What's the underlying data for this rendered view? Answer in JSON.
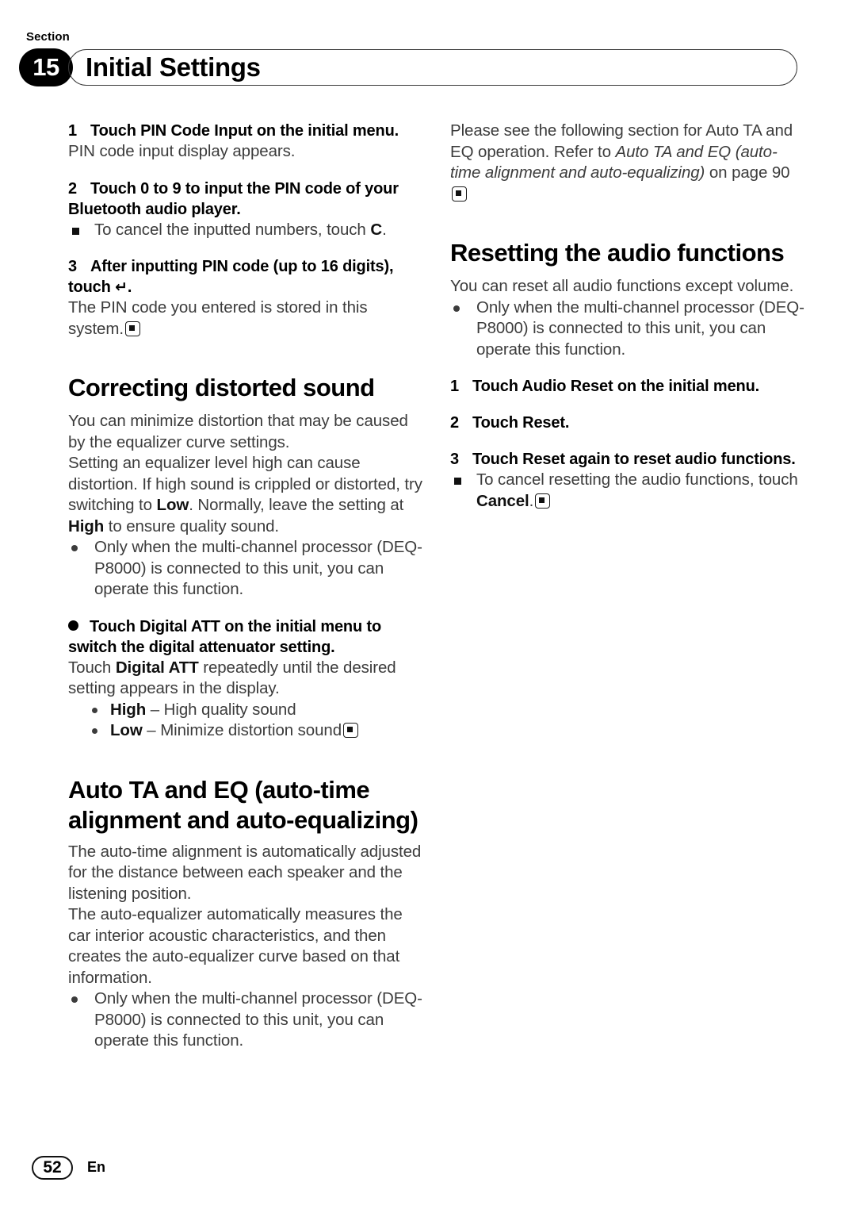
{
  "header": {
    "section_label": "Section",
    "section_number": "15",
    "title": "Initial Settings"
  },
  "left_column": {
    "steps": [
      {
        "num": "1",
        "text_pre": "Touch ",
        "text_bold": "PIN Code Input",
        "text_post": " on the initial menu.",
        "full": "1   Touch PIN Code Input on the initial menu.",
        "body": "PIN code input display appears."
      },
      {
        "num": "2",
        "full": "2   Touch 0 to 9 to input the PIN code of your Bluetooth audio player.",
        "note_pre": "To cancel the inputted numbers, touch ",
        "note_bold": "C",
        "note_post": "."
      },
      {
        "num": "3",
        "full": "3   After inputting PIN code (up to 16 digits), touch ",
        "key_glyph": "↵",
        "full_tail": ".",
        "body": "The PIN code you entered is stored in this system."
      }
    ],
    "heading_correcting": "Correcting distorted sound",
    "correcting_para_1": "You can minimize distortion that may be caused by the equalizer curve settings.",
    "correcting_para_2_a": "Setting an equalizer level high can cause distortion. If high sound is crippled or distorted, try switching to ",
    "correcting_para_2_low": "Low",
    "correcting_para_2_b": ". Normally, leave the setting at ",
    "correcting_para_2_high": "High",
    "correcting_para_2_c": " to ensure quality sound.",
    "bullet_multichannel": "Only when the multi-channel processor (DEQ-P8000) is connected to this unit, you can operate this function.",
    "digital_att_step_a": "Touch ",
    "digital_att_step_bold": "Digital ATT",
    "digital_att_step_b": " on the initial menu to switch the digital attenuator setting.",
    "digital_att_body_a": "Touch ",
    "digital_att_body_bold": "Digital ATT",
    "digital_att_body_b": " repeatedly until the desired setting appears in the display.",
    "sub_items": [
      {
        "term": "High",
        "dash": " – ",
        "desc": "High quality sound",
        "endmark": false
      },
      {
        "term": "Low",
        "dash": " – ",
        "desc": "Minimize distortion sound",
        "endmark": true
      }
    ],
    "heading_auto_ta": "Auto TA and EQ (auto-time alignment and auto-equalizing)",
    "auto_para_1": "The auto-time alignment is automatically adjusted for the distance between each speaker and the listening position.",
    "auto_para_2": "The auto-equalizer automatically measures the car interior acoustic characteristics, and then creates the auto-equalizer curve based on that information.",
    "auto_bullet": "Only when the multi-channel processor (DEQ-P8000) is connected to this unit, you can operate this function."
  },
  "right_column": {
    "intro_a": "Please see the following section for Auto TA and EQ operation. Refer to ",
    "intro_italic_1": "Auto TA and EQ",
    "intro_b": " ",
    "intro_italic_2": "(auto-time alignment and auto-equalizing)",
    "intro_c": " on page 90",
    "heading_resetting": "Resetting the audio functions",
    "resetting_para": "You can reset all audio functions except volume.",
    "resetting_bullet": "Only when the multi-channel processor (DEQ-P8000) is connected to this unit, you can operate this function.",
    "steps": [
      {
        "num": "1",
        "full": "1   Touch Audio Reset on the initial menu."
      },
      {
        "num": "2",
        "full": "2   Touch Reset."
      },
      {
        "num": "3",
        "full": "3   Touch Reset again to reset audio functions."
      }
    ],
    "note_a": "To cancel resetting the audio functions, touch ",
    "note_bold": "Cancel",
    "note_b": "."
  },
  "footer": {
    "page_number": "52",
    "language": "En"
  }
}
